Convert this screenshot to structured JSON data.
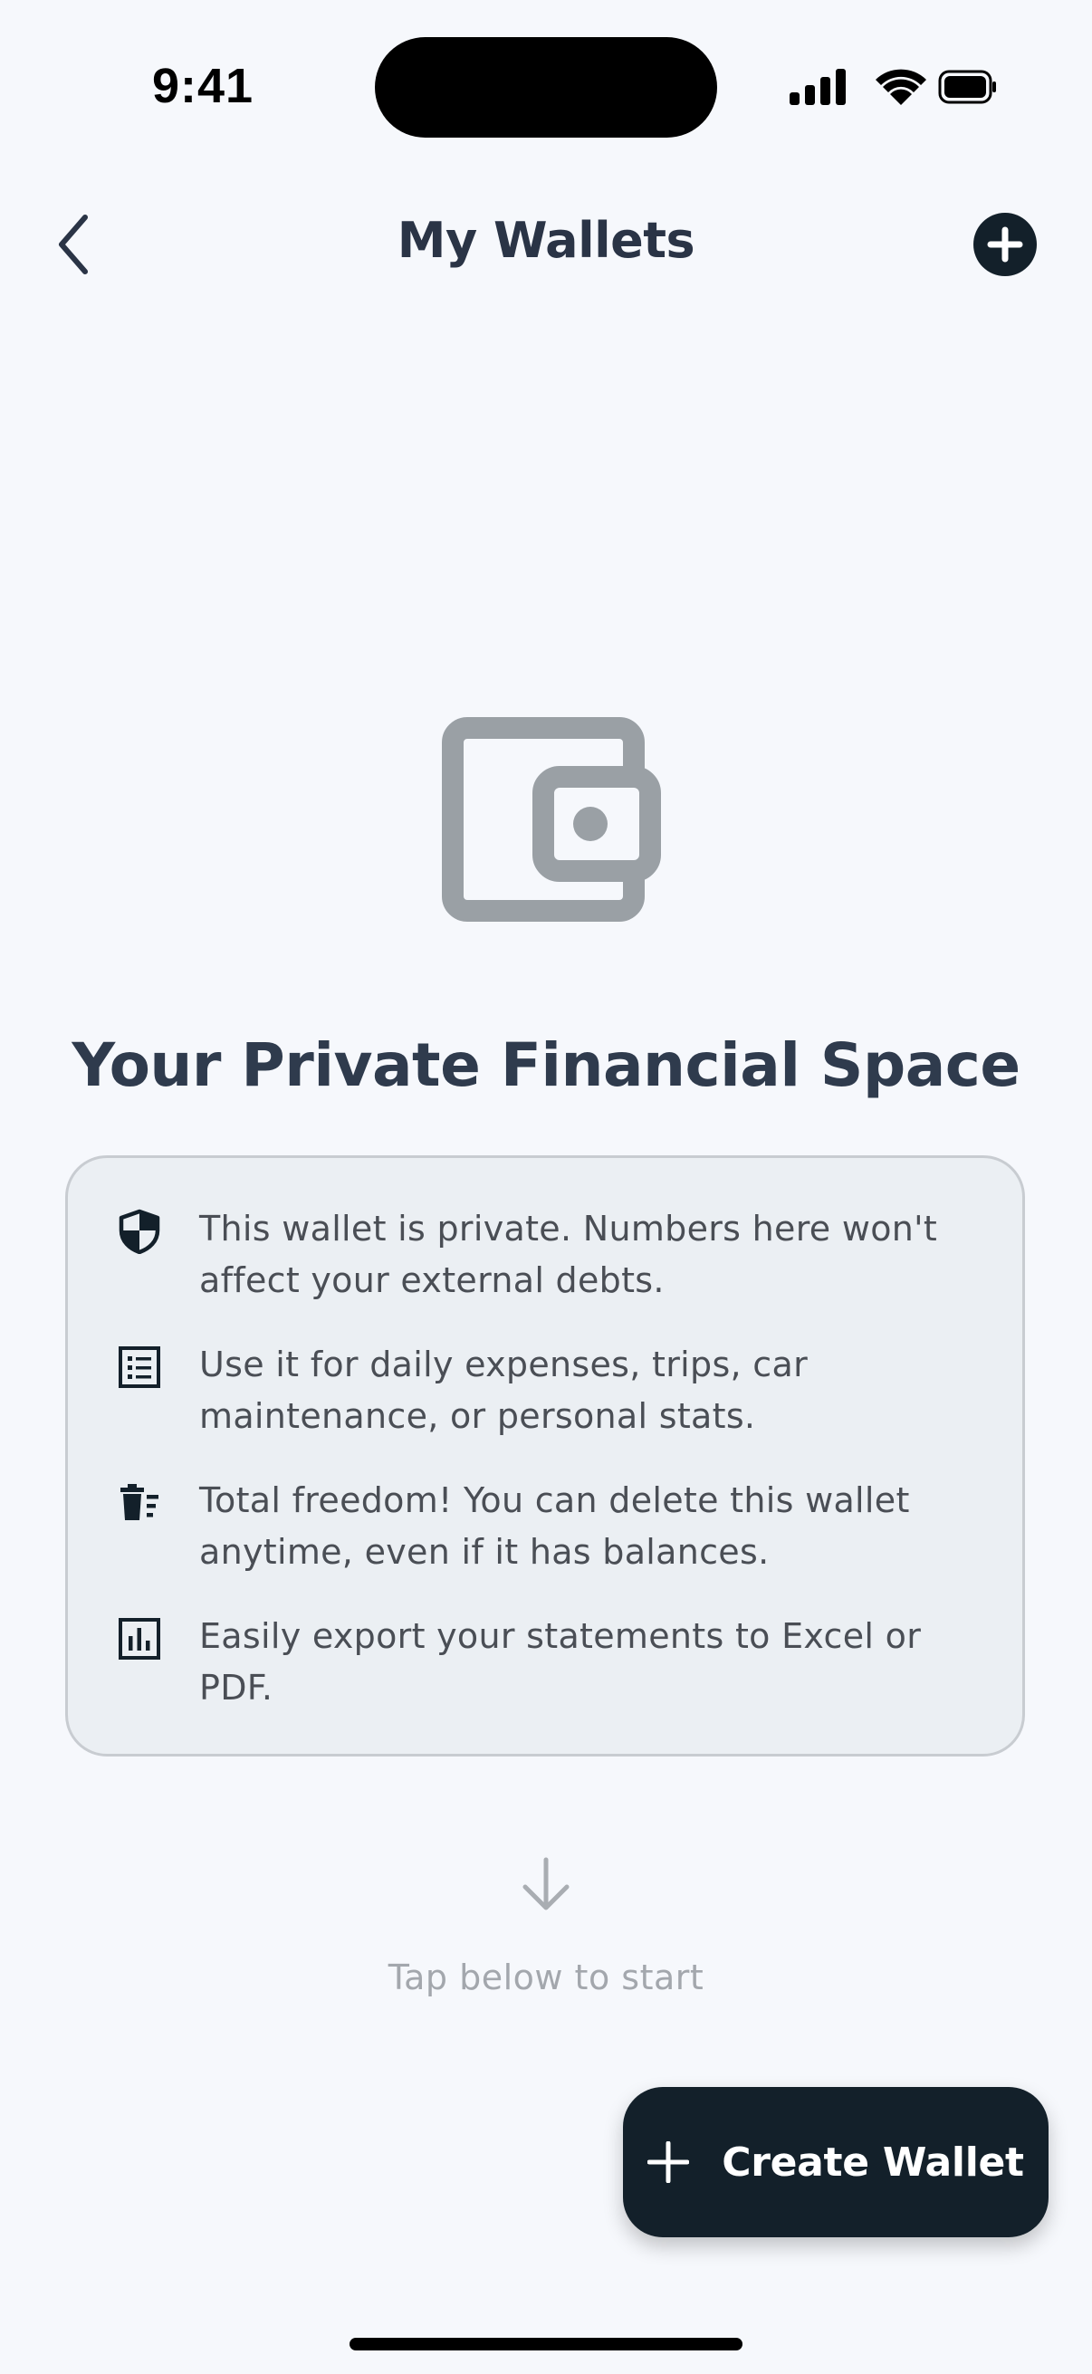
{
  "status_bar": {
    "time": "9:41"
  },
  "nav": {
    "title": "My Wallets",
    "back_icon": "chevron-left-icon",
    "add_icon": "plus-circle-icon"
  },
  "hero": {
    "icon": "wallet-icon",
    "title": "Your Private Financial Space"
  },
  "info_items": [
    {
      "icon": "shield-icon",
      "text": "This wallet is private. Numbers here won't affect your external debts."
    },
    {
      "icon": "list-icon",
      "text": "Use it for daily expenses, trips, car maintenance, or personal stats."
    },
    {
      "icon": "trash-icon",
      "text": "Total freedom! You can delete this wallet anytime, even if it has balances."
    },
    {
      "icon": "bar-chart-icon",
      "text": "Easily export your statements to Excel or PDF."
    }
  ],
  "hint": {
    "icon": "arrow-down-icon",
    "text": "Tap below to start"
  },
  "create_button": {
    "icon": "plus-icon",
    "label": "Create Wallet"
  },
  "colors": {
    "background": "#f6f8fc",
    "primary_dark": "#13202a",
    "card_background": "#ebeff3",
    "muted_icon": "#9aa0a5",
    "hint_text": "#a3a7ad"
  }
}
